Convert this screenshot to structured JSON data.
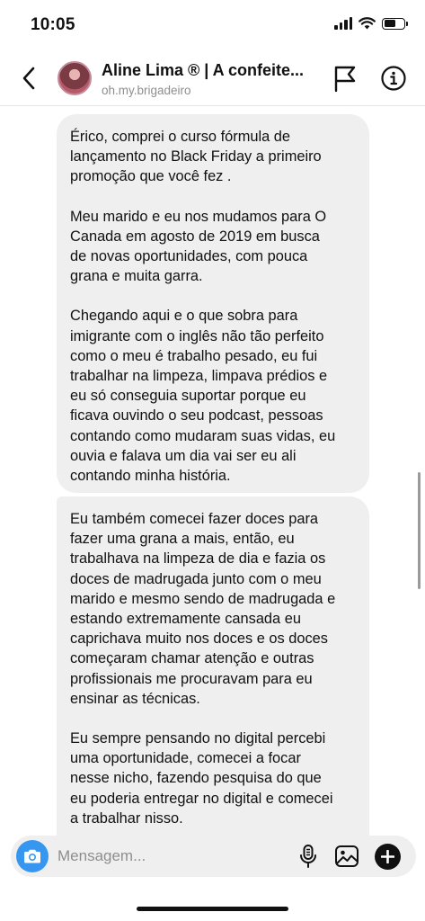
{
  "status_bar": {
    "time": "10:05",
    "icons": [
      "cellular-signal-icon",
      "wifi-icon",
      "battery-icon"
    ]
  },
  "header": {
    "title": "Aline Lima ® | A confeite...",
    "username": "oh.my.brigadeiro",
    "icons": [
      "back-chevron-icon",
      "flag-icon",
      "info-icon"
    ]
  },
  "messages": [
    {
      "paragraphs": [
        "Érico, comprei o curso fórmula de\nlançamento no Black Friday a primeiro\npromoção que você fez .",
        "Meu marido e eu nos mudamos para O\nCanada em agosto de 2019 em busca\nde novas oportunidades, com pouca\ngrana e muita garra.",
        "Chegando aqui e o que sobra para\nimigrante com o inglês  não tão perfeito\ncomo o meu é trabalho pesado, eu fui\ntrabalhar na limpeza, limpava prédios e\neu só conseguia suportar porque eu\nficava ouvindo o seu podcast, pessoas\ncontando como mudaram suas vidas, eu\nouvia e falava um dia vai ser eu ali\ncontando minha história."
      ]
    },
    {
      "paragraphs": [
        "Eu também comecei fazer doces para\nfazer uma grana a mais, então, eu\ntrabalhava na limpeza de dia e fazia os\ndoces de madrugada junto com o meu\nmarido e mesmo sendo de madrugada e\nestando extremamente cansada eu\ncaprichava muito nos doces e os doces\ncomeçaram chamar atenção e outras\nprofissionais me procuravam para eu\nensinar as técnicas.",
        "Eu sempre pensando no digital percebi\numa oportunidade, comecei a focar\nnesse nicho, fazendo pesquisa do que\neu poderia entregar no digital e comecei\na trabalhar nisso."
      ]
    }
  ],
  "composer": {
    "placeholder": "Mensagem...",
    "value": "",
    "icons": [
      "camera-icon",
      "microphone-icon",
      "gallery-icon",
      "plus-icon"
    ]
  },
  "colors": {
    "bubble_background": "#efefef",
    "camera_button": "#3797f0",
    "secondary_text": "#8e8e8e"
  }
}
